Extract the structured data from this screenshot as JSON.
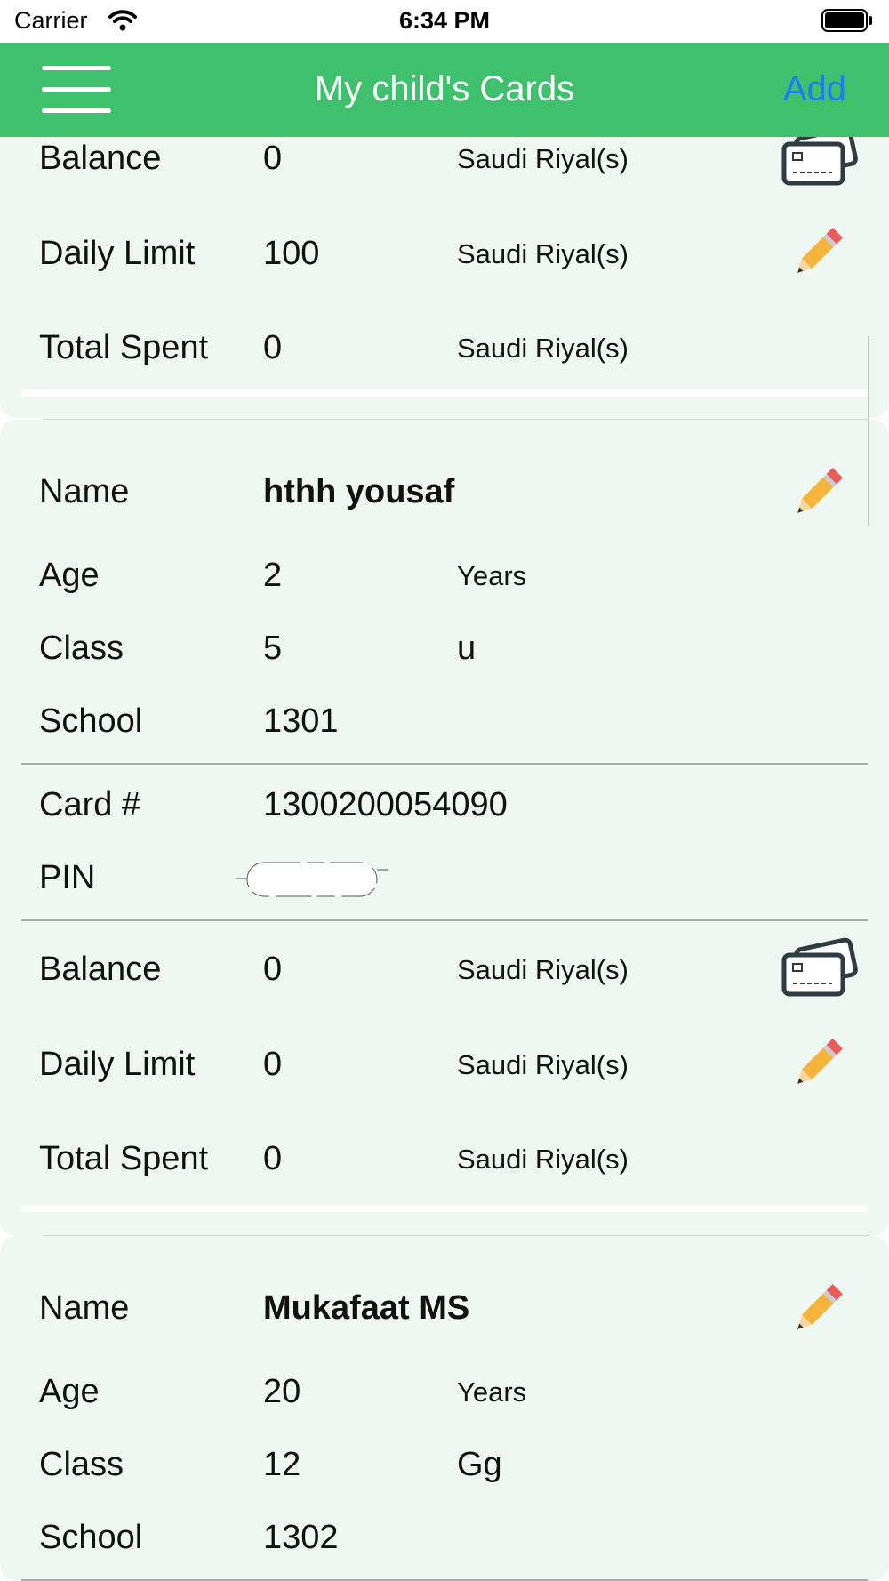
{
  "status_bar": {
    "carrier": "Carrier",
    "time": "6:34 PM"
  },
  "nav": {
    "title": "My child's Cards",
    "add_label": "Add"
  },
  "labels": {
    "name": "Name",
    "age": "Age",
    "class": "Class",
    "school": "School",
    "card_number": "Card #",
    "pin": "PIN",
    "balance": "Balance",
    "daily_limit": "Daily Limit",
    "total_spent": "Total Spent",
    "years": "Years",
    "currency": "Saudi Riyal(s)"
  },
  "cards": [
    {
      "balance": "0",
      "daily_limit": "100",
      "total_spent": "0"
    },
    {
      "name": "hthh yousaf",
      "age": "2",
      "class": "5",
      "section": "u",
      "school": "1301",
      "card_number": "1300200054090",
      "balance": "0",
      "daily_limit": "0",
      "total_spent": "0"
    },
    {
      "name": "Mukafaat MS",
      "age": "20",
      "class": "12",
      "section": "Gg",
      "school": "1302"
    }
  ],
  "colors": {
    "nav_green": "#3fc06c",
    "add_blue": "#1e7cf5",
    "card_bg": "#eef7f1"
  },
  "icons": [
    "menu-icon",
    "wallet-icon",
    "pencil-icon",
    "wifi-icon",
    "battery-icon"
  ]
}
